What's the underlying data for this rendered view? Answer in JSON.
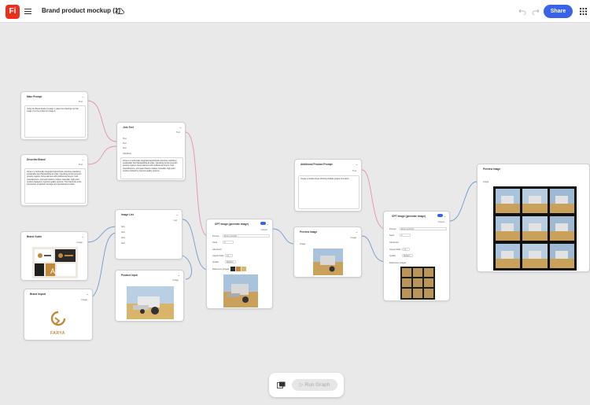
{
  "app": {
    "logo_text": "Fi",
    "document_title": "Brand product mockup (1)",
    "share_label": "Share"
  },
  "nodes": {
    "main_prompt": {
      "title": "Main Prompt",
      "output": "Text",
      "text": "Using the Brand Guide in image 1, place the brand lgo on Farr image 2 on the product in image 3."
    },
    "describe_brand": {
      "title": "Describe Brand",
      "output": "Text",
      "text": "Farya is a technically integrated agricultural enterprise redefining sustainable food Stewardship at scale. Operating across premium growing regions, Farya partners with institutional buyers, food manufacturers, and retail chains to deliver traceable, high-yield produce backed by rigorous quality systems. The brand sits at the intersection of agrarian heritage and operational precision."
    },
    "join_text": {
      "title": "Join Text",
      "output": "Text",
      "port_1": "Text",
      "port_2": "Text",
      "port_3": "Text",
      "separator_label": "(Newline)",
      "text": "Farya is a technically integrated agricultural enterprise redefining sustainable food Stewardship at scale. Operating across premium growing regions, Farya partners with institutional buyers, food manufacturers, and retail chains to deliver traceable, high-yield produce backed by rigorous quality systems."
    },
    "brand_guide": {
      "title": "Brand Guide",
      "output": "Image"
    },
    "brand_import": {
      "title": "Brand Import",
      "output": "Image",
      "logo_wordmark": "FARYA"
    },
    "image_list": {
      "title": "Image List",
      "output": "List",
      "port_1": "Item",
      "port_2": "Item",
      "port_3": "Item",
      "port_4": "Item"
    },
    "product_input": {
      "title": "Product Input",
      "output": "Image"
    },
    "gpt_image_1": {
      "title": "GPT Image (generate image)",
      "output": "Output",
      "prompt_label": "Prompt",
      "prompt_placeholder": "Enter a prompt…",
      "seed_label": "Seed",
      "seed_value": "0",
      "advanced_label": "Advanced",
      "aspect_label": "Aspect Ratio",
      "aspect_value": "1:1",
      "quality_label": "Quality",
      "quality_value": "Medium",
      "ref_label": "Reference Images"
    },
    "preview_image_1": {
      "title": "Preview Image",
      "output": "Image",
      "input_label": "Image"
    },
    "additional_prompt": {
      "title": "Additional Product Prompt",
      "output": "Text",
      "text": "Create a contact sheet showing multiple angles of product"
    },
    "gpt_image_2": {
      "title": "GPT Image (generate image)",
      "output": "Output",
      "prompt_label": "Prompt",
      "prompt_placeholder": "Enter a prompt…",
      "seed_label": "Seed",
      "seed_value": "0",
      "advanced_label": "Advanced",
      "aspect_label": "Aspect Ratio",
      "aspect_value": "1:1",
      "quality_label": "Quality",
      "quality_value": "Medium",
      "ref_label": "Reference Images"
    },
    "preview_image_2": {
      "title": "Preview Image",
      "input_label": "Image"
    }
  },
  "run_graph": {
    "label": "Run Graph"
  },
  "colors": {
    "accent": "#3b63e8",
    "text_wire": "#e58fb3",
    "image_wire": "#6e9bd1",
    "logo_red": "#e8321e",
    "brand_gold": "#c08a3a"
  }
}
